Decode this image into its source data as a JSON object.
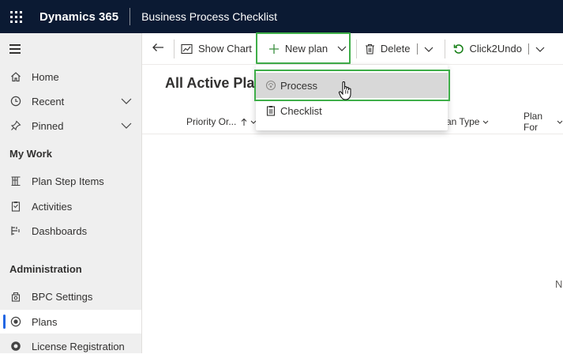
{
  "topbar": {
    "brand": "Dynamics 365",
    "app_name": "Business Process Checklist"
  },
  "sidebar": {
    "items": [
      {
        "label": "Home",
        "icon": "home-icon"
      },
      {
        "label": "Recent",
        "icon": "clock-icon"
      },
      {
        "label": "Pinned",
        "icon": "pin-icon"
      }
    ],
    "section_my_work": "My Work",
    "my_work": [
      {
        "label": "Plan Step Items",
        "icon": "steps-icon"
      },
      {
        "label": "Activities",
        "icon": "clipboard-icon"
      },
      {
        "label": "Dashboards",
        "icon": "dashboard-icon"
      }
    ],
    "section_admin": "Administration",
    "admin": [
      {
        "label": "BPC Settings",
        "icon": "settings-icon"
      },
      {
        "label": "Plans",
        "icon": "plans-icon",
        "selected": true
      },
      {
        "label": "License Registration",
        "icon": "license-icon"
      }
    ]
  },
  "commandbar": {
    "show_chart": "Show Chart",
    "new_plan": "New plan",
    "delete": "Delete",
    "click2undo": "Click2Undo"
  },
  "page": {
    "title": "All Active Plar",
    "columns": [
      "Priority Or...",
      "an Type",
      "Plan For"
    ],
    "fragment": "N"
  },
  "dropdown": {
    "items": [
      "Process",
      "Checklist"
    ],
    "highlighted": "Process"
  },
  "colors": {
    "topbar": "#0b1a33",
    "highlight_border": "#3fae49",
    "selection": "#2266e3",
    "undo": "#107c10"
  }
}
